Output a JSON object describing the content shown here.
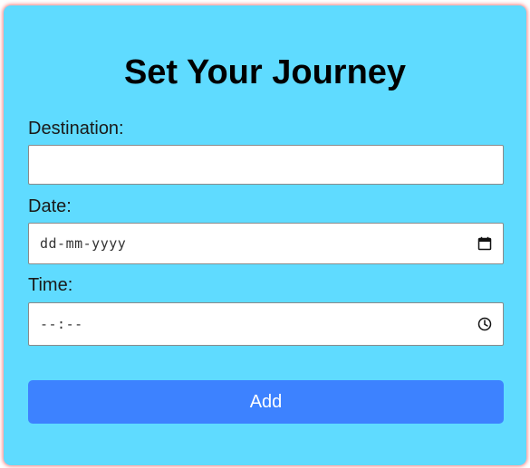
{
  "form": {
    "title": "Set Your Journey",
    "destination": {
      "label": "Destination:",
      "value": ""
    },
    "date": {
      "label": "Date:",
      "placeholder": "dd-mm-yyyy",
      "icon": "calendar-icon"
    },
    "time": {
      "label": "Time:",
      "placeholder": "--:--",
      "icon": "clock-icon"
    },
    "add_label": "Add"
  },
  "colors": {
    "card_background": "#5fdbff",
    "card_glow": "#ff5050",
    "button_background": "#3d82ff",
    "button_text": "#ffffff"
  }
}
